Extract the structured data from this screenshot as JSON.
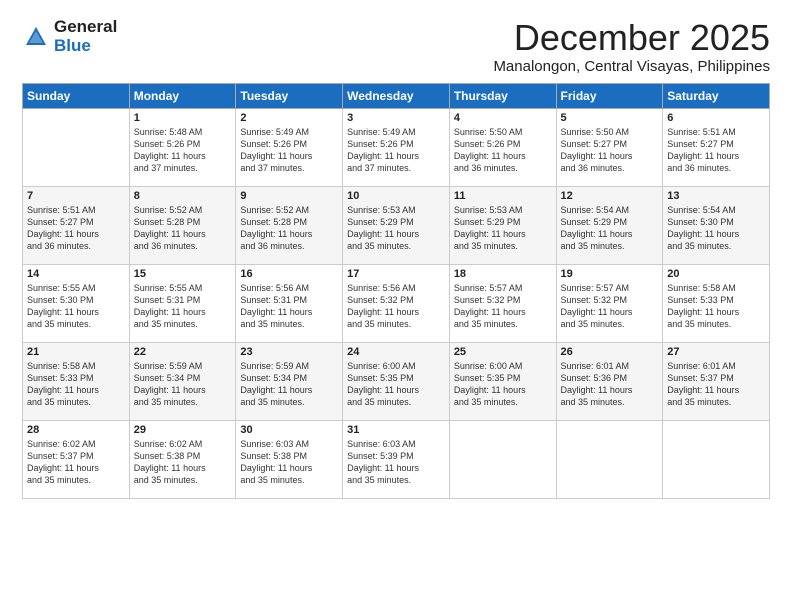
{
  "logo": {
    "general": "General",
    "blue": "Blue"
  },
  "title": "December 2025",
  "location": "Manalongon, Central Visayas, Philippines",
  "days_header": [
    "Sunday",
    "Monday",
    "Tuesday",
    "Wednesday",
    "Thursday",
    "Friday",
    "Saturday"
  ],
  "weeks": [
    [
      {
        "num": "",
        "info": ""
      },
      {
        "num": "1",
        "info": "Sunrise: 5:48 AM\nSunset: 5:26 PM\nDaylight: 11 hours\nand 37 minutes."
      },
      {
        "num": "2",
        "info": "Sunrise: 5:49 AM\nSunset: 5:26 PM\nDaylight: 11 hours\nand 37 minutes."
      },
      {
        "num": "3",
        "info": "Sunrise: 5:49 AM\nSunset: 5:26 PM\nDaylight: 11 hours\nand 37 minutes."
      },
      {
        "num": "4",
        "info": "Sunrise: 5:50 AM\nSunset: 5:26 PM\nDaylight: 11 hours\nand 36 minutes."
      },
      {
        "num": "5",
        "info": "Sunrise: 5:50 AM\nSunset: 5:27 PM\nDaylight: 11 hours\nand 36 minutes."
      },
      {
        "num": "6",
        "info": "Sunrise: 5:51 AM\nSunset: 5:27 PM\nDaylight: 11 hours\nand 36 minutes."
      }
    ],
    [
      {
        "num": "7",
        "info": "Sunrise: 5:51 AM\nSunset: 5:27 PM\nDaylight: 11 hours\nand 36 minutes."
      },
      {
        "num": "8",
        "info": "Sunrise: 5:52 AM\nSunset: 5:28 PM\nDaylight: 11 hours\nand 36 minutes."
      },
      {
        "num": "9",
        "info": "Sunrise: 5:52 AM\nSunset: 5:28 PM\nDaylight: 11 hours\nand 36 minutes."
      },
      {
        "num": "10",
        "info": "Sunrise: 5:53 AM\nSunset: 5:29 PM\nDaylight: 11 hours\nand 35 minutes."
      },
      {
        "num": "11",
        "info": "Sunrise: 5:53 AM\nSunset: 5:29 PM\nDaylight: 11 hours\nand 35 minutes."
      },
      {
        "num": "12",
        "info": "Sunrise: 5:54 AM\nSunset: 5:29 PM\nDaylight: 11 hours\nand 35 minutes."
      },
      {
        "num": "13",
        "info": "Sunrise: 5:54 AM\nSunset: 5:30 PM\nDaylight: 11 hours\nand 35 minutes."
      }
    ],
    [
      {
        "num": "14",
        "info": "Sunrise: 5:55 AM\nSunset: 5:30 PM\nDaylight: 11 hours\nand 35 minutes."
      },
      {
        "num": "15",
        "info": "Sunrise: 5:55 AM\nSunset: 5:31 PM\nDaylight: 11 hours\nand 35 minutes."
      },
      {
        "num": "16",
        "info": "Sunrise: 5:56 AM\nSunset: 5:31 PM\nDaylight: 11 hours\nand 35 minutes."
      },
      {
        "num": "17",
        "info": "Sunrise: 5:56 AM\nSunset: 5:32 PM\nDaylight: 11 hours\nand 35 minutes."
      },
      {
        "num": "18",
        "info": "Sunrise: 5:57 AM\nSunset: 5:32 PM\nDaylight: 11 hours\nand 35 minutes."
      },
      {
        "num": "19",
        "info": "Sunrise: 5:57 AM\nSunset: 5:32 PM\nDaylight: 11 hours\nand 35 minutes."
      },
      {
        "num": "20",
        "info": "Sunrise: 5:58 AM\nSunset: 5:33 PM\nDaylight: 11 hours\nand 35 minutes."
      }
    ],
    [
      {
        "num": "21",
        "info": "Sunrise: 5:58 AM\nSunset: 5:33 PM\nDaylight: 11 hours\nand 35 minutes."
      },
      {
        "num": "22",
        "info": "Sunrise: 5:59 AM\nSunset: 5:34 PM\nDaylight: 11 hours\nand 35 minutes."
      },
      {
        "num": "23",
        "info": "Sunrise: 5:59 AM\nSunset: 5:34 PM\nDaylight: 11 hours\nand 35 minutes."
      },
      {
        "num": "24",
        "info": "Sunrise: 6:00 AM\nSunset: 5:35 PM\nDaylight: 11 hours\nand 35 minutes."
      },
      {
        "num": "25",
        "info": "Sunrise: 6:00 AM\nSunset: 5:35 PM\nDaylight: 11 hours\nand 35 minutes."
      },
      {
        "num": "26",
        "info": "Sunrise: 6:01 AM\nSunset: 5:36 PM\nDaylight: 11 hours\nand 35 minutes."
      },
      {
        "num": "27",
        "info": "Sunrise: 6:01 AM\nSunset: 5:37 PM\nDaylight: 11 hours\nand 35 minutes."
      }
    ],
    [
      {
        "num": "28",
        "info": "Sunrise: 6:02 AM\nSunset: 5:37 PM\nDaylight: 11 hours\nand 35 minutes."
      },
      {
        "num": "29",
        "info": "Sunrise: 6:02 AM\nSunset: 5:38 PM\nDaylight: 11 hours\nand 35 minutes."
      },
      {
        "num": "30",
        "info": "Sunrise: 6:03 AM\nSunset: 5:38 PM\nDaylight: 11 hours\nand 35 minutes."
      },
      {
        "num": "31",
        "info": "Sunrise: 6:03 AM\nSunset: 5:39 PM\nDaylight: 11 hours\nand 35 minutes."
      },
      {
        "num": "",
        "info": ""
      },
      {
        "num": "",
        "info": ""
      },
      {
        "num": "",
        "info": ""
      }
    ]
  ]
}
